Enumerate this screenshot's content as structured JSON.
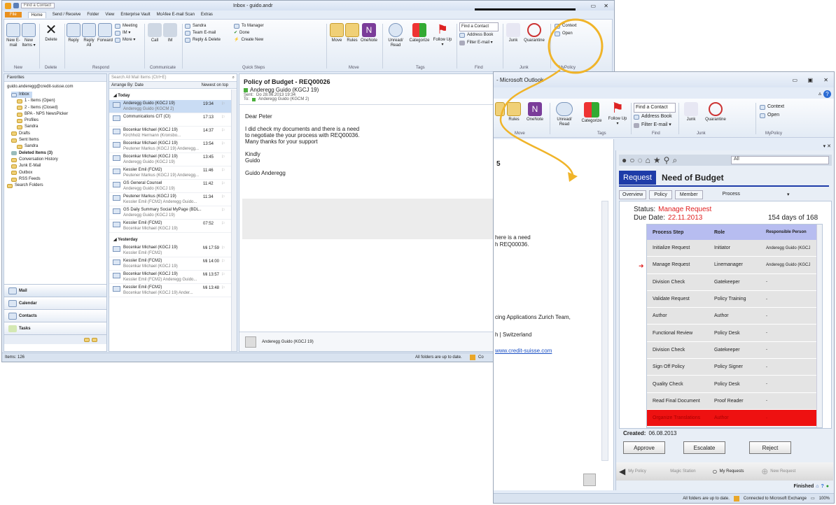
{
  "main": {
    "qat_search": "Find a Contact",
    "title": "Inbox - guido.andr",
    "tabs": [
      "File",
      "Home",
      "Send / Receive",
      "Folder",
      "View",
      "Enterprise Vault",
      "McAfee E-mail Scan",
      "Extras"
    ],
    "ribbon": {
      "new": [
        "New E-mail",
        "New Items ▾"
      ],
      "delete": "Delete",
      "respond": [
        "Reply",
        "Reply All",
        "Forward"
      ],
      "respond_small": [
        "Meeting",
        "IM ▾",
        "More ▾"
      ],
      "communicate": [
        "Call",
        "IM"
      ],
      "quicksteps": [
        "Sandra",
        "Team E-mail",
        "Reply & Delete",
        "To Manager",
        "Done",
        "Create New"
      ],
      "move": [
        "Move",
        "Rules",
        "OneNote"
      ],
      "tags": [
        "Unread/ Read",
        "Categorize",
        "Follow Up ▾"
      ],
      "find": [
        "Find a Contact",
        "Address Book",
        "Filter E-mail ▾"
      ],
      "junk": [
        "Junk",
        "Quarantine"
      ],
      "mypolicy": [
        "Context",
        "Open"
      ],
      "groups": [
        "New",
        "Delete",
        "Respond",
        "Communicate",
        "Quick Steps",
        "Move",
        "Tags",
        "Find",
        "Junk",
        "MyPolicy"
      ]
    },
    "favorites": "Favorites",
    "account": "guido.anderegg@credit-suisse.com",
    "folders": [
      "Inbox",
      "1 - Items (Open)",
      "2 - Items (Closed)",
      "BPA - NPS NewsPicker",
      "Profiles",
      "Sandra",
      "Drafts",
      "Sent Items",
      "Sandra",
      "Deleted Items (3)",
      "Conversation History",
      "Junk E-Mail",
      "Outbox",
      "RSS Feeds",
      "Search Folders"
    ],
    "nav": [
      "Mail",
      "Calendar",
      "Contacts",
      "Tasks"
    ],
    "search_placeholder": "Search All Mail Items (Ctrl+E)",
    "arrange": "Arrange By: Date",
    "order": "Newest on top",
    "group_today": "Today",
    "group_yesterday": "Yesterday",
    "mails_today": [
      {
        "from": "Anderegg Guido (KGCJ 19)",
        "sub": "Anderegg Guido (KGCM 2)",
        "time": "19:34"
      },
      {
        "from": "Communications CIT (CI)",
        "sub": "",
        "time": "17:13"
      },
      {
        "from": "Bocenkar Michael (KGCJ 19)",
        "sub": "Kirchholz Hermann (Kronsbo...",
        "time": "14:37"
      },
      {
        "from": "Bocenkar Michael (KGCJ 19)",
        "sub": "Peutener Markus (KGCJ 19) Anderegg...",
        "time": "13:54"
      },
      {
        "from": "Bocenkar Michael (KGCJ 19)",
        "sub": "Anderegg Guido (KGCJ 19)",
        "time": "13:45"
      },
      {
        "from": "Kessler Emil (FCM2)",
        "sub": "Peutener Markus (KGCJ 19) Anderegg...",
        "time": "11:46"
      },
      {
        "from": "GS General Counsel",
        "sub": "Anderegg Guido (KGCJ 19)",
        "time": "11:42"
      },
      {
        "from": "Peutener Markus (KGCJ 19)",
        "sub": "Kessler Emil (FCM2) Anderegg Guido...",
        "time": "11:34"
      },
      {
        "from": "GS Daily Summary Social MyPage (BDL...",
        "sub": "Anderegg Guido (KGCJ 19)",
        "time": ""
      },
      {
        "from": "Kessler Emil (FCM2)",
        "sub": "Bocenkar Michael (KGCJ 19)",
        "time": "07:52"
      }
    ],
    "mails_yesterday": [
      {
        "from": "Bocenkar Michael (KGCJ 19)",
        "sub": "Kessler Emil (FCM2)",
        "time": "Mi 17:59"
      },
      {
        "from": "Kessler Emil (FCM2)",
        "sub": "Bocenkar Michael (KGCJ 19)",
        "time": "Mi 14:00"
      },
      {
        "from": "Bocenkar Michael (KGCJ 19)",
        "sub": "Kessler Emil (FCM2) Anderegg Guido...",
        "time": "Mi 13:57"
      },
      {
        "from": "Kessler Emil (FCM2)",
        "sub": "Bocenkar Michael (KGCJ 19) Ander...",
        "time": "Mi 13:48"
      }
    ],
    "reading": {
      "subject": "Policy of Budget - REQ00026",
      "from": "Anderegg Guido (KGCJ 19)",
      "sent_label": "Sent:",
      "sent": "Do 28.06.2013 19:34",
      "to_label": "To:",
      "to": "Anderegg Guido (KGCM 2)",
      "greeting": "Dear Peter",
      "body1": "I did check my documents and there is a need",
      "body2": "to negotiate the your process with REQ00036.",
      "body3": "Many thanks for your support",
      "closing1": "Kindly",
      "closing2": "Guido",
      "signature": "Guido Anderegg",
      "people": "Anderegg Guido (KGCJ 19)"
    },
    "status_items": "Items: 126",
    "status_right": "All folders are up to date.",
    "status_conn": "Co"
  },
  "second": {
    "title": "- Microsoft Outlook",
    "ribbon": {
      "move": [
        "Rules",
        "OneNote"
      ],
      "tags": [
        "Unread/ Read",
        "Categorize",
        "Follow Up ▾"
      ],
      "find": [
        "Find a Contact",
        "Address Book",
        "Filter E-mail ▾"
      ],
      "junk": [
        "Junk",
        "Quarantine"
      ],
      "mypolicy": [
        "Context",
        "Open"
      ],
      "groups": [
        "Move",
        "Tags",
        "Find",
        "Junk",
        "MyPolicy"
      ]
    },
    "body_partial": [
      "5",
      "here is a need",
      "h REQ00036.",
      "cing Applications Zurich Team,",
      "h | Switzerland"
    ],
    "link": "www.credit-suisse.com",
    "status_right": "All folders are up to date.",
    "status_conn": "Connected to Microsoft Exchange",
    "zoom": "100%"
  },
  "panel": {
    "filter": "All",
    "badge": "Request",
    "title": "Need of Budget",
    "tabs": [
      "Overview",
      "Policy",
      "Member",
      "Process"
    ],
    "status_label": "Status:",
    "status_value": "Manage Request",
    "due_label": "Due Date:",
    "due_value": "22.11.2013",
    "days": "154 days of 168",
    "headers": [
      "Process Step",
      "Role",
      "Responsible Person"
    ],
    "rows": [
      {
        "step": "Initialize Request",
        "role": "Initiator",
        "person": "Anderegg Guido (KGCJ"
      },
      {
        "step": "Manage Request",
        "role": "Linemanager",
        "person": "Anderegg Guido (KGCJ"
      },
      {
        "step": "Division Check",
        "role": "Gatekeeper",
        "person": "-"
      },
      {
        "step": "Validate Request",
        "role": "Policy Training",
        "person": "-"
      },
      {
        "step": "Author",
        "role": "Author",
        "person": "-"
      },
      {
        "step": "Functional Review",
        "role": "Policy Desk",
        "person": "-"
      },
      {
        "step": "Division Check",
        "role": "Gatekeeper",
        "person": "-"
      },
      {
        "step": "Sign Off Policy",
        "role": "Policy Signer",
        "person": "-"
      },
      {
        "step": "Quality Check",
        "role": "Policy Desk",
        "person": "-"
      },
      {
        "step": "Read Final Document",
        "role": "Proof Reader",
        "person": "-"
      },
      {
        "step": "Organize Translations",
        "role": "Author",
        "person": "-"
      }
    ],
    "created_label": "Created:",
    "created": "06.08.2013",
    "buttons": [
      "Approve",
      "Escalate",
      "Reject"
    ],
    "bottom_nav": [
      "My Policy",
      "Magic Station",
      "My Requests",
      "New Request"
    ],
    "finished": "Finished"
  },
  "colors": {
    "accent": "#f0b429",
    "status_red": "#e02020",
    "badge_blue": "#1e3ca8",
    "file_tab": "#e9901e"
  }
}
